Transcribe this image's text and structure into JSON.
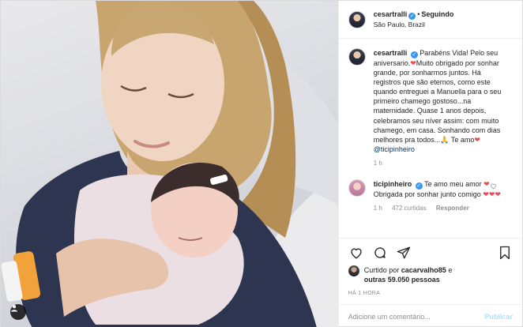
{
  "header": {
    "username": "cesartralli",
    "verified_mark": "✓",
    "separator": "•",
    "follow_status": "Seguindo",
    "location": "São Paulo, Brazil"
  },
  "caption": {
    "username": "cesartralli",
    "text_1": "Parabéns Vida! Pelo seu aniversario.",
    "heart": "❤",
    "text_2": "Muito obrigado por sonhar grande, por sonharmos juntos. Há registros que são eternos, como este quando entreguei a Manuella para o seu primeiro chamego gostoso...na maternidade. Quase 1 anos depois, celebramos seu níver assim: com muito chamego, em casa. Sonhando com dias melhores pra todos...",
    "emoji_hands": "🙏",
    "text_3": "Te amo",
    "mention": "@ticipinheiro",
    "time": "1 h"
  },
  "comment": {
    "username": "ticipinheiro",
    "text_1": "Te amo meu amor",
    "text_2": "Obrigada por sonhar junto comigo",
    "hearts": "❤❤❤",
    "time": "1 h",
    "likes": "472 curtidas",
    "reply": "Responder"
  },
  "likes_line": {
    "prefix": "Curtido por",
    "user": "cacarvalho85",
    "conj": "e",
    "others": "outras 59.050 pessoas"
  },
  "timestamp": "HÁ 1 HORA",
  "add_comment": {
    "placeholder": "Adicione um comentário...",
    "publish": "Publicar"
  },
  "colors": {
    "accent": "#3897f0",
    "heart": "#ed4956",
    "muted": "#8e8e8e",
    "publish_disabled": "#b2dffc"
  }
}
